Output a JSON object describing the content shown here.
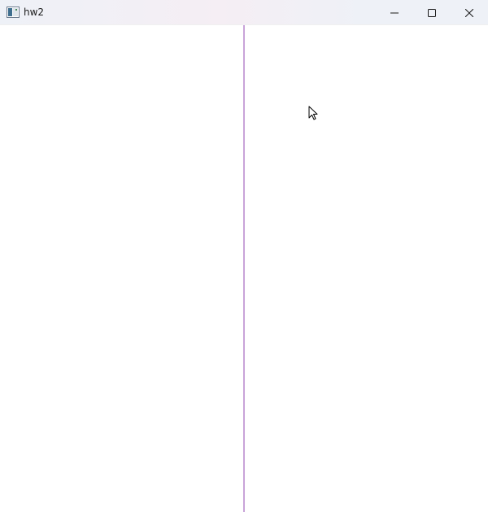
{
  "window": {
    "title": "hw2",
    "icon": "app-window-icon",
    "controls": {
      "minimize_icon": "minimize-icon",
      "maximize_icon": "maximize-icon",
      "close_icon": "close-icon"
    }
  },
  "colors": {
    "divider": "#c9a3d9",
    "background": "#ffffff"
  }
}
